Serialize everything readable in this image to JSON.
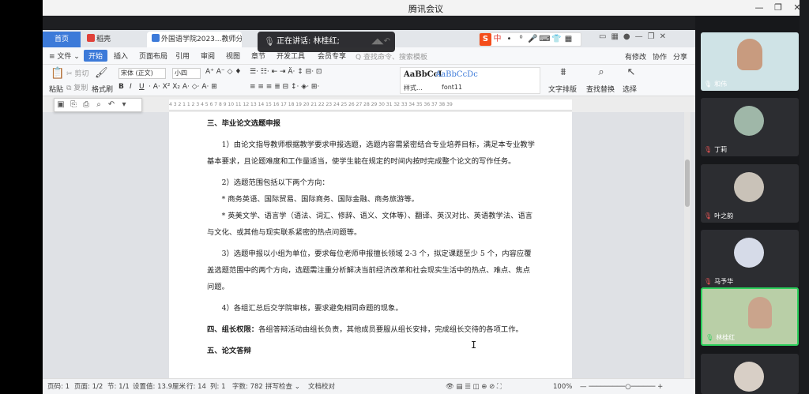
{
  "meeting": {
    "title": "腾讯会议",
    "controls": [
      "—",
      "❐",
      "✕"
    ]
  },
  "tabs": {
    "home": "首页",
    "docer": "稻壳",
    "doc": "外国语学院2023...教师分配方案"
  },
  "speaking": {
    "label": "正在讲话: 林桂红;"
  },
  "ime": {
    "logo": "S",
    "items": [
      "中",
      "•",
      "⁰",
      "🎤",
      "⌨",
      "👕",
      "▦"
    ]
  },
  "menu": {
    "file": "≡ 文件 ⌄",
    "items": [
      "开始",
      "插入",
      "页面布局",
      "引用",
      "审阅",
      "视图",
      "章节",
      "开发工具",
      "会员专享"
    ],
    "search": "Q 查找命令、搜索模板",
    "right": [
      "有修改",
      "协作",
      "分享"
    ]
  },
  "ribbon": {
    "paste": "粘贴",
    "cut": "剪切",
    "copy": "复制",
    "format_painter": "格式刷",
    "font": "宋体 (正文)",
    "size": "小四",
    "style1": "AaBbCcI",
    "style2": "AaBbCcDc",
    "style1_name": "样式...",
    "style2_name": "font11",
    "text_layout": "文字排版",
    "find_replace": "查找替换",
    "select": "选择"
  },
  "ruler": "4  3  2  1  1  2  3  4  5  6  7  8  9  10  11  12  13  14  15  16  17  18  19  20  21  22  23  24  25  26  27  28  29  30  31  32  33  34  35  36  37  38  39",
  "doc": {
    "h3": "三、毕业论文选题申报",
    "p1": "1）由论文指导教师根据教学要求申报选题，选题内容需紧密结合专业培养目标，满足本专业教学基本要求，且论题难度和工作量适当，使学生能在规定的时间内按时完成整个论文的写作任务。",
    "p2": "2）选题范围包括以下两个方向：",
    "p2a": "* 商务英语、国际贸易、国际商务、国际金融、商务旅游等。",
    "p2b": "* 英美文学、语言学（语法、词汇、修辞、语义、文体等）、翻译、英汉对比、英语教学法、语言与文化、或其他与现实联系紧密的热点问题等。",
    "p3": "3）选题申报以小组为单位，要求每位老师申报擅长领域 2-3 个，拟定课题至少 5 个，内容应覆盖选题范围中的两个方向，选题需注重分析解决当前经济改革和社会现实生活中的热点、难点、焦点问题。",
    "p4": "4）各组汇总后交学院审核，要求避免相同命题的现象。",
    "h4_title": "四、组长权限：",
    "h4_body": "各组答辩活动由组长负责，其他成员要服从组长安排，完成组长交待的各项工作。",
    "h5": "五、论文答辩"
  },
  "status": {
    "page": "页码: 1",
    "pages": "页面: 1/2",
    "section": "节: 1/1",
    "position": "设置值: 13.9厘米",
    "row": "行: 14",
    "col": "列: 1",
    "words": "字数: 782",
    "spell": "拼写检查 ⌄",
    "proof": "文档校对",
    "zoom": "100%"
  },
  "participants": [
    {
      "name": "和伟",
      "muted": false
    },
    {
      "name": "丁莉",
      "muted": true
    },
    {
      "name": "叶之韵",
      "muted": true
    },
    {
      "name": "马予华",
      "muted": true
    },
    {
      "name": "林桂红",
      "muted": false
    },
    {
      "name": "",
      "muted": true
    }
  ]
}
